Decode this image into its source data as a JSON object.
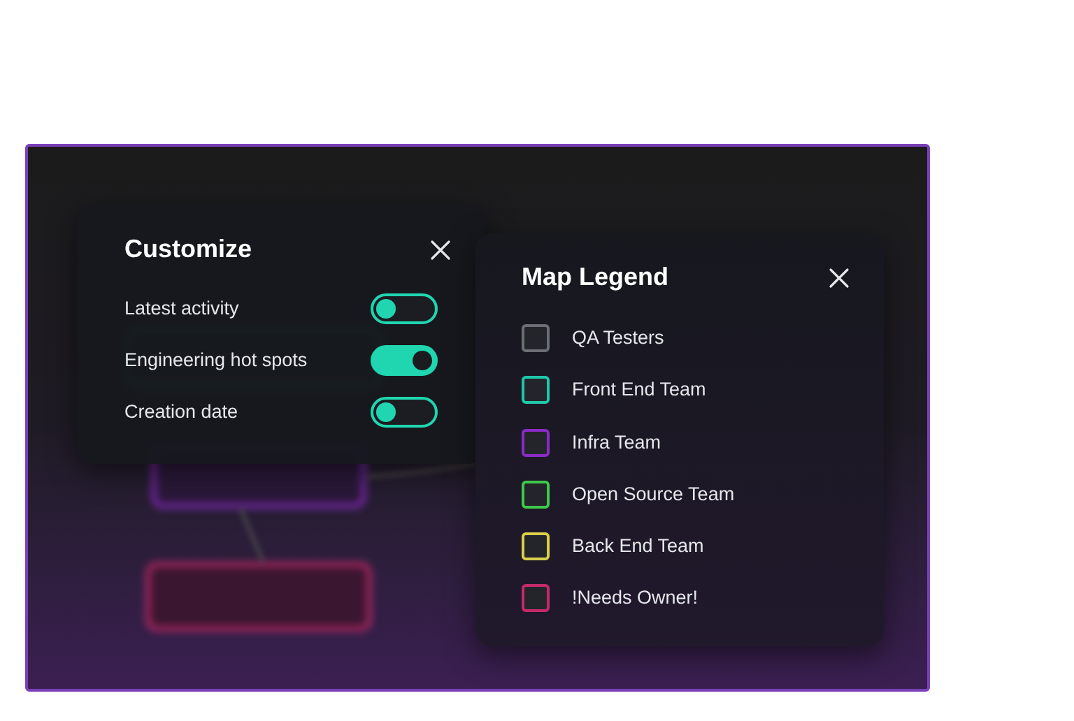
{
  "customize": {
    "title": "Customize",
    "options": [
      {
        "label": "Latest activity",
        "on": false
      },
      {
        "label": "Engineering hot spots",
        "on": true
      },
      {
        "label": "Creation date",
        "on": false
      }
    ]
  },
  "legend": {
    "title": "Map Legend",
    "items": [
      {
        "label": "QA Testers",
        "color": "#6b6e74"
      },
      {
        "label": "Front End Team",
        "color": "#1fc7a8"
      },
      {
        "label": "Infra Team",
        "color": "#8a2bc4"
      },
      {
        "label": "Open Source Team",
        "color": "#3ec94a"
      },
      {
        "label": "Back End Team",
        "color": "#d9cf4a"
      },
      {
        "label": "!Needs Owner!",
        "color": "#c42a6a"
      }
    ]
  }
}
